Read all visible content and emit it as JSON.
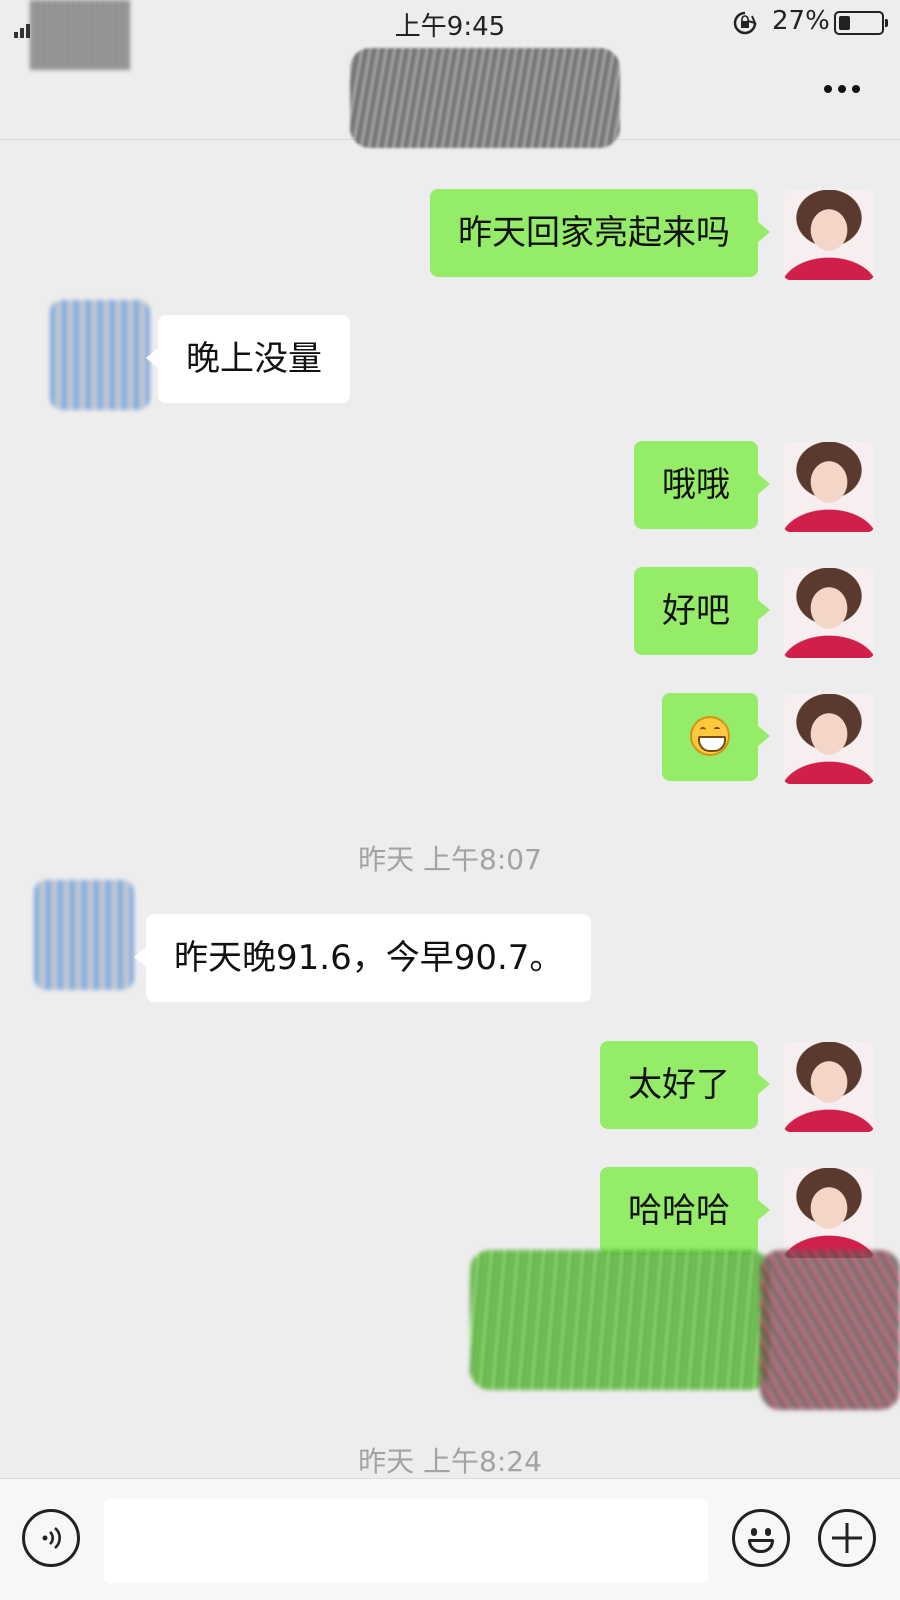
{
  "status_bar": {
    "time": "上午9:45",
    "battery_percent": "27%",
    "battery_level": 0.27
  },
  "messages": [
    {
      "side": "me",
      "text": "昨天回家亮起来吗"
    },
    {
      "side": "other",
      "text": "晚上没量"
    },
    {
      "side": "me",
      "text": "哦哦"
    },
    {
      "side": "me",
      "text": "好吧"
    },
    {
      "side": "me",
      "emoji": "grinning-face"
    },
    {
      "timestamp": "昨天 上午8:07"
    },
    {
      "side": "other",
      "text": "昨天晚91.6，今早90.7。"
    },
    {
      "side": "me",
      "text": "太好了"
    },
    {
      "side": "me",
      "text": "哈哈哈"
    },
    {
      "side": "me",
      "redacted": true
    },
    {
      "timestamp": "昨天 上午8:24"
    }
  ],
  "input_bar": {
    "placeholder": "",
    "icons": [
      "voice-icon",
      "emoji-icon",
      "plus-icon"
    ]
  },
  "colors": {
    "bubble_me": "#95ec69",
    "bubble_other": "#ffffff",
    "background": "#ededed"
  }
}
